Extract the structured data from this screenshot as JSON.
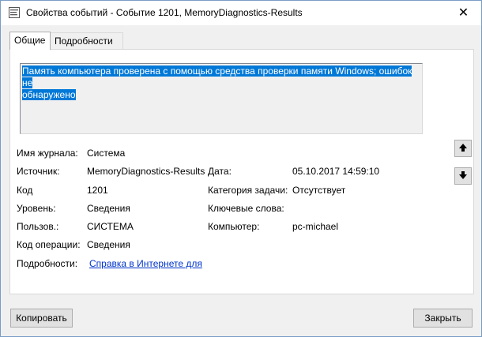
{
  "window": {
    "title": "Свойства событий - Событие 1201, MemoryDiagnostics-Results",
    "close_label": "✕"
  },
  "tabs": [
    {
      "label": "Общие",
      "active": true
    },
    {
      "label": "Подробности",
      "active": false
    }
  ],
  "description": {
    "line1": "Память компьютера проверена с помощью средства проверки памяти Windows; ошибок не",
    "line2": "обнаружено"
  },
  "fields": {
    "log_name_label": "Имя журнала:",
    "log_name_value": "Система",
    "source_label": "Источник:",
    "source_value": "MemoryDiagnostics-Results",
    "date_label": "Дата:",
    "date_value": "05.10.2017 14:59:10",
    "code_label": "Код",
    "code_value": "1201",
    "task_category_label": "Категория задачи:",
    "task_category_value": "Отсутствует",
    "level_label": "Уровень:",
    "level_value": "Сведения",
    "keywords_label": "Ключевые слова:",
    "keywords_value": "",
    "user_label": "Пользов.:",
    "user_value": "СИСТЕМА",
    "computer_label": "Компьютер:",
    "computer_value": "pc-michael",
    "opcode_label": "Код операции:",
    "opcode_value": "Сведения",
    "details_label": "Подробности:",
    "details_link": "Справка в Интернете для"
  },
  "buttons": {
    "copy": "Копировать",
    "close": "Закрыть",
    "prev_icon": "arrow-up-icon",
    "next_icon": "arrow-down-icon"
  }
}
